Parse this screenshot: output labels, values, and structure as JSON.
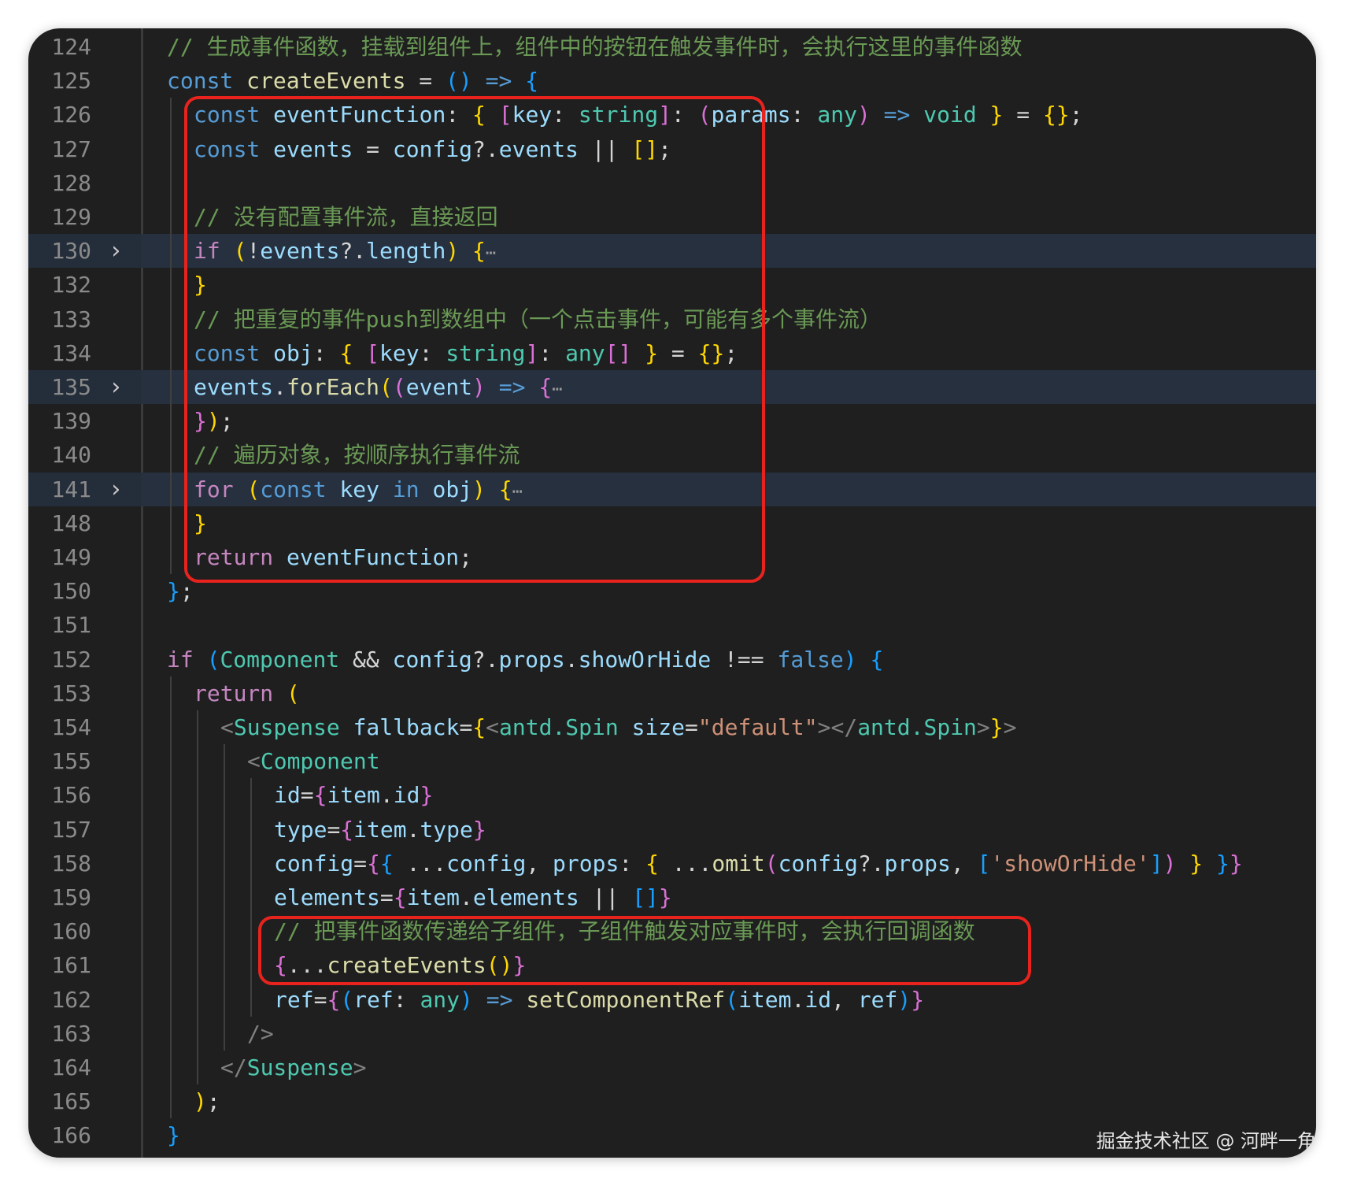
{
  "editor": {
    "theme_background": "#1f1f1f",
    "highlight_box_color": "#e8231d",
    "lines": [
      {
        "num": "124",
        "text": "// 生成事件函数，挂载到组件上，组件中的按钮在触发事件时，会执行这里的事件函数"
      },
      {
        "num": "125",
        "text": "const createEvents = () => {"
      },
      {
        "num": "126",
        "text": "const eventFunction: { [key: string]: (params: any) => void } = {};"
      },
      {
        "num": "127",
        "text": "const events = config?.events || [];"
      },
      {
        "num": "128",
        "text": ""
      },
      {
        "num": "129",
        "text": "// 没有配置事件流，直接返回"
      },
      {
        "num": "130",
        "text": "if (!events?.length) {"
      },
      {
        "num": "132",
        "text": "}"
      },
      {
        "num": "133",
        "text": "// 把重复的事件push到数组中（一个点击事件，可能有多个事件流）"
      },
      {
        "num": "134",
        "text": "const obj: { [key: string]: any[] } = {};"
      },
      {
        "num": "135",
        "text": "events.forEach((event) => {"
      },
      {
        "num": "139",
        "text": "});"
      },
      {
        "num": "140",
        "text": "// 遍历对象，按顺序执行事件流"
      },
      {
        "num": "141",
        "text": "for (const key in obj) {"
      },
      {
        "num": "148",
        "text": "}"
      },
      {
        "num": "149",
        "text": "return eventFunction;"
      },
      {
        "num": "150",
        "text": "};"
      },
      {
        "num": "151",
        "text": ""
      },
      {
        "num": "152",
        "text": "if (Component && config?.props.showOrHide !== false) {"
      },
      {
        "num": "153",
        "text": "return ("
      },
      {
        "num": "154",
        "text": "<Suspense fallback={<antd.Spin size=\"default\"></antd.Spin>}>"
      },
      {
        "num": "155",
        "text": "<Component"
      },
      {
        "num": "156",
        "text": "id={item.id}"
      },
      {
        "num": "157",
        "text": "type={item.type}"
      },
      {
        "num": "158",
        "text": "config={{ ...config, props: { ...omit(config?.props, ['showOrHide']) } }}"
      },
      {
        "num": "159",
        "text": "elements={item.elements || []}"
      },
      {
        "num": "160",
        "text": "// 把事件函数传递给子组件，子组件触发对应事件时，会执行回调函数"
      },
      {
        "num": "161",
        "text": "{...createEvents()}"
      },
      {
        "num": "162",
        "text": "ref={(ref: any) => setComponentRef(item.id, ref)}"
      },
      {
        "num": "163",
        "text": "/>"
      },
      {
        "num": "164",
        "text": "</Suspense>"
      },
      {
        "num": "165",
        "text": ");"
      },
      {
        "num": "166",
        "text": "}"
      }
    ],
    "fold_markers": {
      "chevron": "›",
      "ellipsis": "⋯"
    }
  },
  "watermark": "掘金技术社区 @ 河畔一角"
}
